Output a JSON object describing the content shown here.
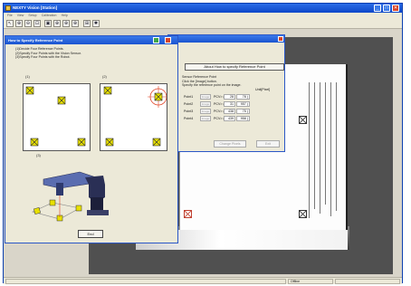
{
  "app": {
    "title": "NEXTY Vision [Station]",
    "menu": [
      "File",
      "View",
      "Setup",
      "Calibration",
      "Help"
    ],
    "toolbar_icons": [
      "pointer-icon",
      "zoom-in-icon",
      "zoom-out-icon",
      "zoom-fit-icon",
      "zoom-100-icon",
      "zoom-a-icon",
      "zoom-b-icon",
      "zoom-c-icon",
      "grid-icon",
      "settings-icon"
    ],
    "toolbar_glyphs": [
      "↖",
      "⊕",
      "⊖",
      "⊡",
      "▣",
      "⊕",
      "⊕",
      "⊕",
      "⊞",
      "✱"
    ],
    "status": "Offline"
  },
  "settings_dialog": {
    "about_button": "About How to specify Reference Point",
    "sensor_info": [
      "Sensor Reference Point",
      "Click the [Image] button.",
      "Specify the reference point on the image."
    ],
    "unit_label": "Unit[Pixel]",
    "points": [
      {
        "name": "Point1",
        "image_button": "Image",
        "pcv": "PCV> (",
        "x": "28",
        "y": "78 )"
      },
      {
        "name": "Point2",
        "image_button": "Image",
        "pcv": "PCV> (",
        "x": "31",
        "y": "957 )"
      },
      {
        "name": "Point3",
        "image_button": "Image",
        "pcv": "PCV> (",
        "x": "438",
        "y": "75 )"
      },
      {
        "name": "Point4",
        "image_button": "Image",
        "pcv": "PCV> (",
        "x": "439",
        "y": "958 )"
      }
    ],
    "buttons": [
      "Change Pixels",
      "Exit"
    ]
  },
  "howto_dialog": {
    "title": "How to Specify Reference Point",
    "steps": [
      "(1)Decide Four Reference Points.",
      "(2)Specify Four Points with the Vision Sensor.",
      "(3)Specify Four Points with the Robot."
    ],
    "panel_labels": [
      "(1)",
      "(2)",
      "(3)"
    ],
    "ok_button": "End"
  },
  "colors": {
    "title_blue": "#1a54cf",
    "marker_yellow": "#e8e000",
    "target_red": "#e04020"
  }
}
